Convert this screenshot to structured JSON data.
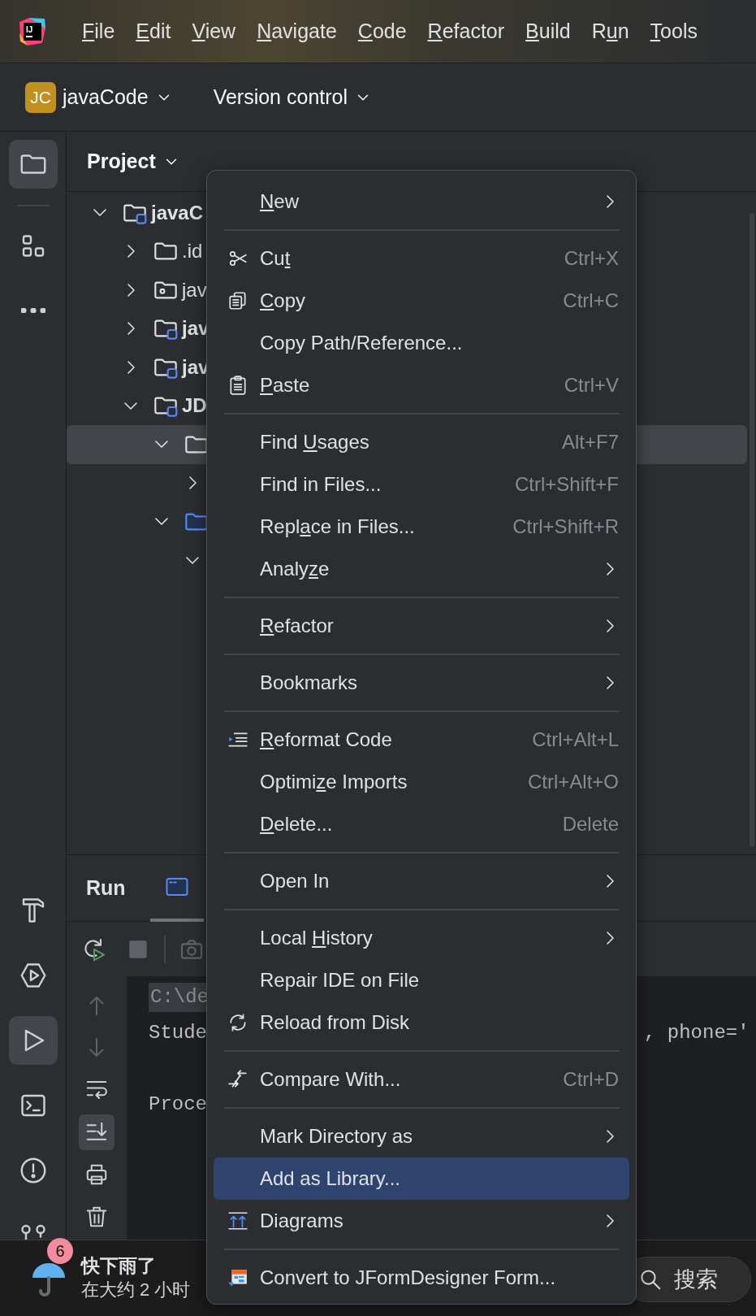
{
  "app_logo": {
    "text": "IJ"
  },
  "menu_bar": [
    {
      "parts": [
        {
          "text": "F",
          "underline": true
        },
        {
          "text": "ile",
          "underline": false
        }
      ]
    },
    {
      "parts": [
        {
          "text": "E",
          "underline": true
        },
        {
          "text": "dit",
          "underline": false
        }
      ]
    },
    {
      "parts": [
        {
          "text": "V",
          "underline": true
        },
        {
          "text": "iew",
          "underline": false
        }
      ]
    },
    {
      "parts": [
        {
          "text": "N",
          "underline": true
        },
        {
          "text": "avigate",
          "underline": false
        }
      ]
    },
    {
      "parts": [
        {
          "text": "C",
          "underline": true
        },
        {
          "text": "ode",
          "underline": false
        }
      ]
    },
    {
      "parts": [
        {
          "text": "R",
          "underline": true
        },
        {
          "text": "efactor",
          "underline": false
        }
      ]
    },
    {
      "parts": [
        {
          "text": "B",
          "underline": true
        },
        {
          "text": "uild",
          "underline": false
        }
      ]
    },
    {
      "parts": [
        {
          "text": "R",
          "underline": false
        },
        {
          "text": "u",
          "underline": true
        },
        {
          "text": "n",
          "underline": false
        }
      ]
    },
    {
      "parts": [
        {
          "text": "T",
          "underline": true
        },
        {
          "text": "ools",
          "underline": false
        }
      ]
    }
  ],
  "toolbar": {
    "project_badge": "JC",
    "project_name": "javaCode",
    "vcs": "Version control"
  },
  "tool_strip": {
    "top": [
      {
        "kind": "project",
        "selected": true
      },
      {
        "kind": "structure",
        "selected": false
      },
      {
        "kind": "more",
        "selected": false
      }
    ],
    "bottom": [
      {
        "kind": "build",
        "selected": false
      },
      {
        "kind": "services",
        "selected": false
      },
      {
        "kind": "run",
        "selected": true
      },
      {
        "kind": "terminal",
        "selected": false
      },
      {
        "kind": "problems",
        "selected": false
      },
      {
        "kind": "git",
        "selected": false
      }
    ]
  },
  "project": {
    "title": "Project",
    "tree": [
      {
        "label": "javaC",
        "kind": "module",
        "expanded": true,
        "selected": false,
        "children": [
          {
            "label": ".id",
            "kind": "folder",
            "expanded": false,
            "selected": false
          },
          {
            "label": "jav",
            "kind": "resources",
            "expanded": false,
            "selected": false
          },
          {
            "label": "jav",
            "kind": "module",
            "expanded": false,
            "selected": false
          },
          {
            "label": "jav",
            "kind": "module",
            "expanded": false,
            "selected": false
          },
          {
            "label": "JD",
            "kind": "module",
            "expanded": true,
            "selected": false,
            "children": [
              {
                "kind": "folder",
                "expanded": true,
                "selected": true,
                "children": [
                  {
                    "expanded": false,
                    "selected": false
                  }
                ]
              },
              {
                "kind": "source",
                "expanded": true,
                "selected": false,
                "children": [
                  {
                    "expanded": true,
                    "selected": false
                  }
                ]
              }
            ]
          }
        ]
      }
    ]
  },
  "run_panel": {
    "title": "Run",
    "tab": {
      "selected": true
    },
    "toolbar": [
      {
        "kind": "rerun",
        "disabled": false
      },
      {
        "kind": "stop",
        "disabled": true
      },
      {
        "kind": "camera",
        "disabled": true
      }
    ],
    "side_actions": [
      {
        "kind": "up",
        "disabled": true,
        "on": false
      },
      {
        "kind": "down",
        "disabled": true,
        "on": false
      },
      {
        "kind": "wrap",
        "disabled": false,
        "on": false
      },
      {
        "kind": "scroll-end",
        "disabled": false,
        "on": true
      },
      {
        "kind": "print",
        "disabled": false,
        "on": false
      },
      {
        "kind": "trash",
        "disabled": false,
        "on": false
      }
    ],
    "console": [
      {
        "kind": "command",
        "text": "C:\\de"
      },
      {
        "kind": "output",
        "text": "Stude",
        "tail": ", phone='"
      },
      {
        "kind": "blank"
      },
      {
        "kind": "output",
        "text": "Proce"
      }
    ]
  },
  "context_menu": {
    "items": [
      {
        "kind": "item",
        "parts": [
          {
            "text": "N",
            "underline": true
          },
          {
            "text": "ew",
            "underline": false
          }
        ],
        "submenu": true,
        "selected": false
      },
      {
        "kind": "separator"
      },
      {
        "kind": "item",
        "parts": [
          {
            "text": "Cu",
            "underline": false
          },
          {
            "text": "t",
            "underline": true
          }
        ],
        "shortcut": "Ctrl+X",
        "selected": false
      },
      {
        "kind": "item",
        "parts": [
          {
            "text": "C",
            "underline": true
          },
          {
            "text": "opy",
            "underline": false
          }
        ],
        "shortcut": "Ctrl+C",
        "selected": false
      },
      {
        "kind": "item",
        "parts": [
          {
            "text": "Copy Path/Reference...",
            "underline": false
          }
        ],
        "selected": false
      },
      {
        "kind": "item",
        "parts": [
          {
            "text": "P",
            "underline": true
          },
          {
            "text": "aste",
            "underline": false
          }
        ],
        "shortcut": "Ctrl+V",
        "selected": false
      },
      {
        "kind": "separator"
      },
      {
        "kind": "item",
        "parts": [
          {
            "text": "Find ",
            "underline": false
          },
          {
            "text": "U",
            "underline": true
          },
          {
            "text": "sages",
            "underline": false
          }
        ],
        "shortcut": "Alt+F7",
        "selected": false
      },
      {
        "kind": "item",
        "parts": [
          {
            "text": "Find in Files...",
            "underline": false
          }
        ],
        "shortcut": "Ctrl+Shift+F",
        "selected": false
      },
      {
        "kind": "item",
        "parts": [
          {
            "text": "Repl",
            "underline": false
          },
          {
            "text": "a",
            "underline": true
          },
          {
            "text": "ce in Files...",
            "underline": false
          }
        ],
        "shortcut": "Ctrl+Shift+R",
        "selected": false
      },
      {
        "kind": "item",
        "parts": [
          {
            "text": "Analy",
            "underline": false
          },
          {
            "text": "z",
            "underline": true
          },
          {
            "text": "e",
            "underline": false
          }
        ],
        "submenu": true,
        "selected": false
      },
      {
        "kind": "separator"
      },
      {
        "kind": "item",
        "parts": [
          {
            "text": "R",
            "underline": true
          },
          {
            "text": "efactor",
            "underline": false
          }
        ],
        "submenu": true,
        "selected": false
      },
      {
        "kind": "separator"
      },
      {
        "kind": "item",
        "parts": [
          {
            "text": "Bookmarks",
            "underline": false
          }
        ],
        "submenu": true,
        "selected": false
      },
      {
        "kind": "separator"
      },
      {
        "kind": "item",
        "parts": [
          {
            "text": "R",
            "underline": true
          },
          {
            "text": "eformat Code",
            "underline": false
          }
        ],
        "shortcut": "Ctrl+Alt+L",
        "selected": false
      },
      {
        "kind": "item",
        "parts": [
          {
            "text": "Optimi",
            "underline": false
          },
          {
            "text": "z",
            "underline": true
          },
          {
            "text": "e Imports",
            "underline": false
          }
        ],
        "shortcut": "Ctrl+Alt+O",
        "selected": false
      },
      {
        "kind": "item",
        "parts": [
          {
            "text": "D",
            "underline": true
          },
          {
            "text": "elete...",
            "underline": false
          }
        ],
        "shortcut": "Delete",
        "selected": false
      },
      {
        "kind": "separator"
      },
      {
        "kind": "item",
        "parts": [
          {
            "text": "Open In",
            "underline": false
          }
        ],
        "submenu": true,
        "selected": false
      },
      {
        "kind": "separator"
      },
      {
        "kind": "item",
        "parts": [
          {
            "text": "Local ",
            "underline": false
          },
          {
            "text": "H",
            "underline": true
          },
          {
            "text": "istory",
            "underline": false
          }
        ],
        "submenu": true,
        "selected": false
      },
      {
        "kind": "item",
        "parts": [
          {
            "text": "Repair IDE on File",
            "underline": false
          }
        ],
        "selected": false
      },
      {
        "kind": "item",
        "parts": [
          {
            "text": "Reload from Disk",
            "underline": false
          }
        ],
        "selected": false
      },
      {
        "kind": "separator"
      },
      {
        "kind": "item",
        "parts": [
          {
            "text": "Compare With...",
            "underline": false
          }
        ],
        "shortcut": "Ctrl+D",
        "selected": false
      },
      {
        "kind": "separator"
      },
      {
        "kind": "item",
        "parts": [
          {
            "text": "Mark Directory as",
            "underline": false
          }
        ],
        "submenu": true,
        "selected": false
      },
      {
        "kind": "item",
        "parts": [
          {
            "text": "Add as Library...",
            "underline": false
          }
        ],
        "selected": true
      },
      {
        "kind": "item",
        "parts": [
          {
            "text": "Diagrams",
            "underline": false
          }
        ],
        "submenu": true,
        "selected": false
      },
      {
        "kind": "separator"
      },
      {
        "kind": "item",
        "parts": [
          {
            "text": "Convert to JFormDesigner Form...",
            "underline": false
          }
        ],
        "selected": false
      }
    ]
  },
  "taskbar": {
    "weather": {
      "badge": "6",
      "title": "快下雨了",
      "subtitle": "在大约 2 小时"
    },
    "search": {
      "label": "搜索"
    }
  }
}
